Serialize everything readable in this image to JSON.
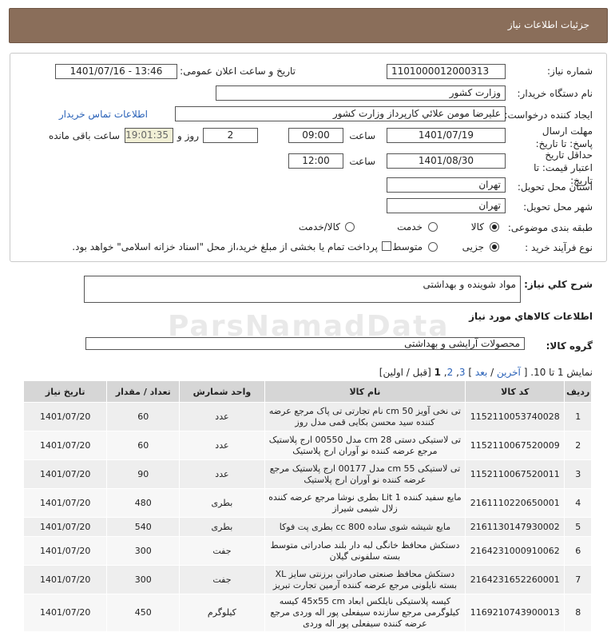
{
  "header": {
    "title": "جزئیات اطلاعات نیاز"
  },
  "form": {
    "need_number_label": "شماره نیاز:",
    "need_number": "1101000012000313",
    "announce_label": "تاریخ و ساعت اعلان عمومی:",
    "announce_value": "1401/07/16 - 13:46",
    "buyer_org_label": "نام دستگاه خریدار:",
    "buyer_org": "وزارت کشور",
    "creator_label": "ایجاد کننده درخواست:",
    "creator": "علیرضا مومن علائي کارپرداز وزارت کشور",
    "contact_link": "اطلاعات تماس خریدار",
    "reply_deadline_label": "مهلت ارسال پاسخ: تا تاریخ:",
    "reply_date": "1401/07/19",
    "time_label": "ساعت",
    "reply_time": "09:00",
    "days_value": "2",
    "days_label": "روز و",
    "remaining_value": "19:01:35",
    "remaining_label": "ساعت باقی مانده",
    "price_validity_label": "حداقل تاریخ اعتبار قیمت: تا تاریخ:",
    "price_date": "1401/08/30",
    "price_time": "12:00",
    "province_label": "استان محل تحویل:",
    "province": "تهران",
    "city_label": "شهر محل تحویل:",
    "city": "تهران",
    "category_label": "طبقه بندی موضوعی:",
    "category_options": [
      "کالا",
      "خدمت",
      "کالا/خدمت"
    ],
    "category_selected": "کالا",
    "process_label": "نوع فرآیند خرید :",
    "process_options": [
      "جزیی",
      "متوسط"
    ],
    "process_selected": "جزیی",
    "payment_note": "پرداخت تمام یا بخشی از مبلغ خرید،از محل \"اسناد خزانه اسلامی\" خواهد بود."
  },
  "summary": {
    "label": "شرح کلي نياز:",
    "value": "مواد شوینده و بهداشتی"
  },
  "goods_info_title": "اطلاعات کالاهاي مورد نياز",
  "goods_group": {
    "label": "گروه کالا:",
    "value": "محصولات آرایشی و بهداشتی"
  },
  "pager": {
    "showing": "نمایش 1 تا 10.",
    "last": "آخرین",
    "next": "بعد",
    "pages": [
      "3",
      "2",
      "1"
    ],
    "prev_first": "[قبل / اولین]"
  },
  "table": {
    "headers": [
      "ردیف",
      "کد کالا",
      "نام کالا",
      "واحد شمارش",
      "تعداد / مقدار",
      "تاریخ نیاز"
    ],
    "rows": [
      {
        "n": "1",
        "code": "1152110053740028",
        "name": "تی نخی آویز 50 cm نام تجارتی تی پاک مرجع عرضه کننده سید محسن بکایی قمی مدل روز",
        "unit": "عدد",
        "qty": "60",
        "date": "1401/07/20"
      },
      {
        "n": "2",
        "code": "1152110067520009",
        "name": "تی لاستیکی دستی 28 cm مدل 00550 ارج پلاستیک مرجع عرضه کننده نو آوران ارج پلاستیک",
        "unit": "عدد",
        "qty": "60",
        "date": "1401/07/20"
      },
      {
        "n": "3",
        "code": "1152110067520011",
        "name": "تی لاستیکی 55 cm مدل 00177 ارج پلاستیک مرجع عرضه کننده نو آوران ارج پلاستیک",
        "unit": "عدد",
        "qty": "90",
        "date": "1401/07/20"
      },
      {
        "n": "4",
        "code": "2161110220650001",
        "name": "مایع سفید کننده 1 Lit بطری نوشا مرجع عرضه کننده زلال شیمی شیراز",
        "unit": "بطری",
        "qty": "480",
        "date": "1401/07/20"
      },
      {
        "n": "5",
        "code": "2161130147930002",
        "name": "مایع شیشه شوی ساده 800 cc بطری پت فوکا",
        "unit": "بطری",
        "qty": "540",
        "date": "1401/07/20"
      },
      {
        "n": "6",
        "code": "2164231000910062",
        "name": "دستکش محافظ خانگی لبه دار بلند صادراتی متوسط بسته سلفونی گیلان",
        "unit": "جفت",
        "qty": "300",
        "date": "1401/07/20"
      },
      {
        "n": "7",
        "code": "2164231652260001",
        "name": "دستکش محافظ صنعتی صادراتی برزنتی سایز XL بسته نایلونی مرجع عرضه کننده آرمین تجارت تبریز",
        "unit": "جفت",
        "qty": "300",
        "date": "1401/07/20"
      },
      {
        "n": "8",
        "code": "1169210743900013",
        "name": "کیسه پلاستیکی نایلکس ابعاد 45x55 cm کیسه کیلوگرمی مرجع سازنده سیفعلی پور اله وردی مرجع عرضه کننده سیفعلی پور اله وردی",
        "unit": "کیلوگرم",
        "qty": "450",
        "date": "1401/07/20"
      }
    ]
  },
  "watermark": "ParsNamadData"
}
